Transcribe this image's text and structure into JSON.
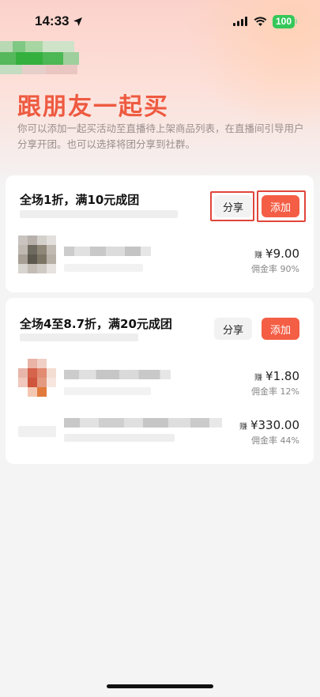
{
  "status_bar": {
    "time": "14:33",
    "battery": "100"
  },
  "hero": {
    "title": "跟朋友一起买",
    "description": "你可以添加一起买活动至直播待上架商品列表，在直播间引导用户分享开团。也可以选择将团分享到社群。"
  },
  "cards": [
    {
      "title": "全场1折，满10元成团",
      "share_label": "分享",
      "add_label": "添加",
      "products": [
        {
          "earn_label": "赚",
          "price": "¥9.00",
          "commission": "佣金率 90%"
        }
      ]
    },
    {
      "title": "全场4至8.7折，满20元成团",
      "share_label": "分享",
      "add_label": "添加",
      "products": [
        {
          "earn_label": "赚",
          "price": "¥1.80",
          "commission": "佣金率 12%"
        },
        {
          "earn_label": "赚",
          "price": "¥330.00",
          "commission": "佣金率 44%"
        }
      ]
    }
  ],
  "colors": {
    "accent": "#f45e45",
    "title": "#ee5a40",
    "battery": "#34c759"
  }
}
